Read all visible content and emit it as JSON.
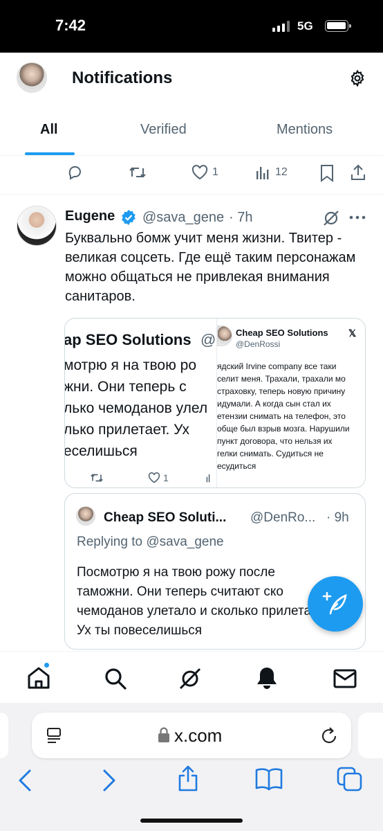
{
  "status": {
    "time": "7:42",
    "network": "5G"
  },
  "header": {
    "title": "Notifications"
  },
  "tabs": [
    {
      "label": "All"
    },
    {
      "label": "Verified"
    },
    {
      "label": "Mentions"
    }
  ],
  "prev_actions": {
    "likes": "1",
    "views": "12"
  },
  "tweet": {
    "name": "Eugene",
    "handle": "@sava_gene",
    "time": "· 7h",
    "text": "Буквально бомж учит меня жизни. Твитер - великая соцсеть. Где ещё таким персонажам можно общаться не привлекая внимания санитаров."
  },
  "quote_image": {
    "left_title": "ap SEO Solutions",
    "left_handle_frag": "@",
    "left_lines": [
      "мотрю я на твою ро",
      "жни. Они теперь с",
      "лько чемоданов улел",
      "лько прилетает. Ух",
      "еселишься"
    ],
    "left_likes": "1",
    "right_name": "Cheap SEO Solutions",
    "right_handle": "@DenRossi",
    "right_lines": [
      "ядский Irvine company все таки",
      "селит меня. Трахали, трахали мо",
      "страховку, теперь новую причину",
      "идумали. А когда сын стал их",
      "етензии снимать на телефон, это",
      "обще был взрыв мозга. Нарушили",
      "пункт договора, что нельзя их",
      "гелки снимать. Судиться не",
      "есудиться"
    ]
  },
  "quote_card": {
    "name": "Cheap SEO Soluti...",
    "handle": "@DenRo...",
    "time": "· 9h",
    "replying_prefix": "Replying to",
    "replying_handle": "@sava_gene",
    "text": "Посмотрю я на твою рожу после таможни. Они теперь считают ско чемоданов улетало и сколько прилетает. Ух ты повеселишься"
  },
  "browser": {
    "url": "x.com"
  },
  "colors": {
    "accent": "#1d9bf0",
    "text": "#0f1419",
    "secondary": "#536471"
  },
  "icons": [
    "gear-icon",
    "reply-icon",
    "retweet-icon",
    "like-icon",
    "views-icon",
    "bookmark-icon",
    "share-icon",
    "grok-icon",
    "more-icon",
    "verified-badge-icon",
    "x-logo-icon",
    "compose-icon",
    "home-icon",
    "search-icon",
    "bell-icon",
    "mail-icon",
    "reader-icon",
    "lock-icon",
    "reload-icon",
    "back-icon",
    "forward-icon",
    "share-sheet-icon",
    "bookmarks-icon",
    "tabs-icon"
  ]
}
